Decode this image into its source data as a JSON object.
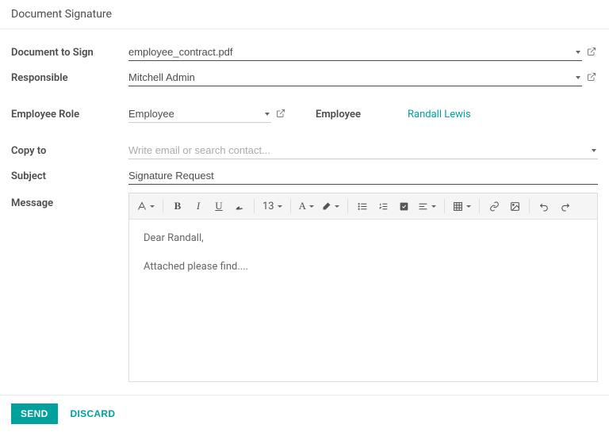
{
  "header": {
    "title": "Document Signature"
  },
  "fields": {
    "document_label": "Document to Sign",
    "document_value": "employee_contract.pdf",
    "responsible_label": "Responsible",
    "responsible_value": "Mitchell Admin",
    "employee_role_label": "Employee Role",
    "employee_role_value": "Employee",
    "employee_label": "Employee",
    "employee_value": "Randall Lewis",
    "copy_to_label": "Copy to",
    "copy_to_placeholder": "Write email or search contact...",
    "subject_label": "Subject",
    "subject_value": "Signature Request",
    "message_label": "Message",
    "message_body_line1": "Dear Randall,",
    "message_body_line2": "Attached please find...."
  },
  "toolbar": {
    "font_size": "13",
    "font_letter": "A"
  },
  "footer": {
    "send": "SEND",
    "discard": "DISCARD"
  }
}
